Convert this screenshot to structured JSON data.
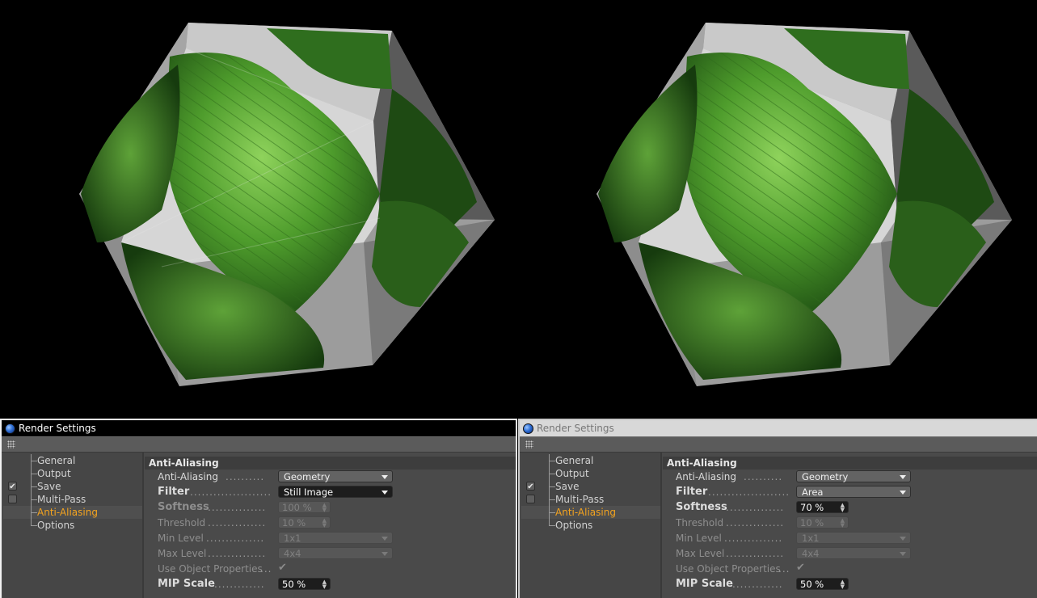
{
  "panels": [
    {
      "title": "Render Settings",
      "nav": [
        "General",
        "Output",
        "Save",
        "Multi-Pass",
        "Anti-Aliasing",
        "Options"
      ],
      "active_nav": "Anti-Aliasing",
      "save_checked": "✔",
      "section": "Anti-Aliasing",
      "fields": {
        "anti_aliasing": {
          "label": "Anti-Aliasing",
          "value": "Geometry"
        },
        "filter": {
          "label": "Filter",
          "value": "Still Image"
        },
        "softness": {
          "label": "Softness",
          "value": "100 %"
        },
        "threshold": {
          "label": "Threshold",
          "value": "10 %"
        },
        "min_level": {
          "label": "Min Level",
          "value": "1x1"
        },
        "max_level": {
          "label": "Max Level",
          "value": "4x4"
        },
        "use_object_properties": {
          "label": "Use Object Properties",
          "value": "✔"
        },
        "mip_scale": {
          "label": "MIP Scale",
          "value": "50 %"
        }
      }
    },
    {
      "title": "Render Settings",
      "nav": [
        "General",
        "Output",
        "Save",
        "Multi-Pass",
        "Anti-Aliasing",
        "Options"
      ],
      "active_nav": "Anti-Aliasing",
      "save_checked": "✔",
      "section": "Anti-Aliasing",
      "fields": {
        "anti_aliasing": {
          "label": "Anti-Aliasing",
          "value": "Geometry"
        },
        "filter": {
          "label": "Filter",
          "value": "Area"
        },
        "softness": {
          "label": "Softness",
          "value": "70 %"
        },
        "threshold": {
          "label": "Threshold",
          "value": "10 %"
        },
        "min_level": {
          "label": "Min Level",
          "value": "1x1"
        },
        "max_level": {
          "label": "Max Level",
          "value": "4x4"
        },
        "use_object_properties": {
          "label": "Use Object Properties",
          "value": "✔"
        },
        "mip_scale": {
          "label": "MIP Scale",
          "value": "50 %"
        }
      }
    }
  ],
  "colors": {
    "active_nav": "#f3a31f",
    "leaf_light": "#5fae3a",
    "leaf_dark": "#1f5a17",
    "face_gray": "#b8b8b8"
  }
}
